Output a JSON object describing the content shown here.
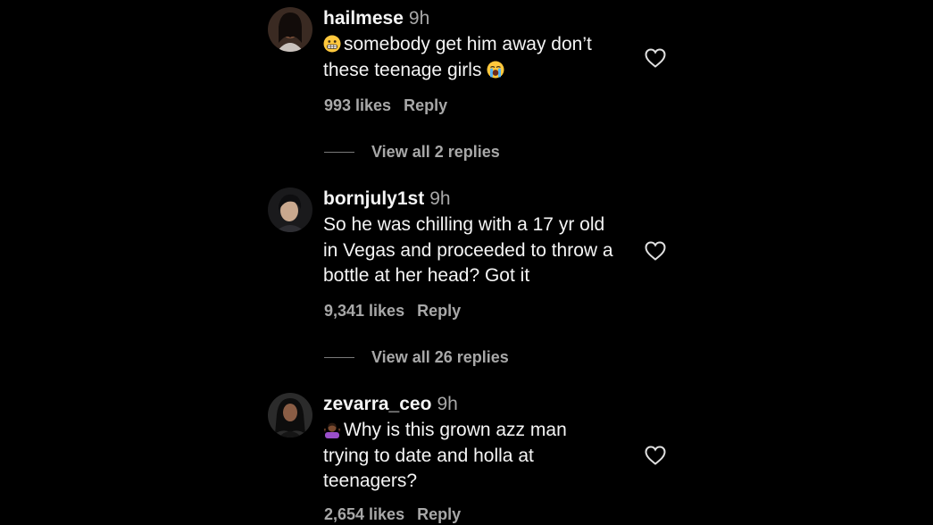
{
  "comments": [
    {
      "username": "hailmese",
      "time": "9h",
      "text_lines": [
        "somebody get him away don’t",
        "these teenage girls"
      ],
      "leading_emoji": "grimacing-face",
      "trailing_emoji": "loudly-crying-face",
      "likes": "993 likes",
      "reply_label": "Reply",
      "view_replies": "View all 2 replies"
    },
    {
      "username": "bornjuly1st",
      "time": "9h",
      "text_lines": [
        "So he was chilling with a 17 yr old",
        "in Vegas and proceeded to throw a",
        "bottle at her head? Got it"
      ],
      "likes": "9,341 likes",
      "reply_label": "Reply",
      "view_replies": "View all 26 replies"
    },
    {
      "username": "zevarra_ceo",
      "time": "9h",
      "text_lines": [
        "Why is this grown azz man",
        "trying to date and holla at",
        "teenagers?"
      ],
      "leading_emoji": "woman-shrugging",
      "likes": "2,654 likes",
      "reply_label": "Reply"
    }
  ],
  "icons": {
    "like": "heart-outline-icon"
  },
  "colors": {
    "background": "#000000",
    "primary_text": "#f5f5f5",
    "secondary_text": "#a8a8a8",
    "emoji_yellow": "#ffc83d"
  }
}
